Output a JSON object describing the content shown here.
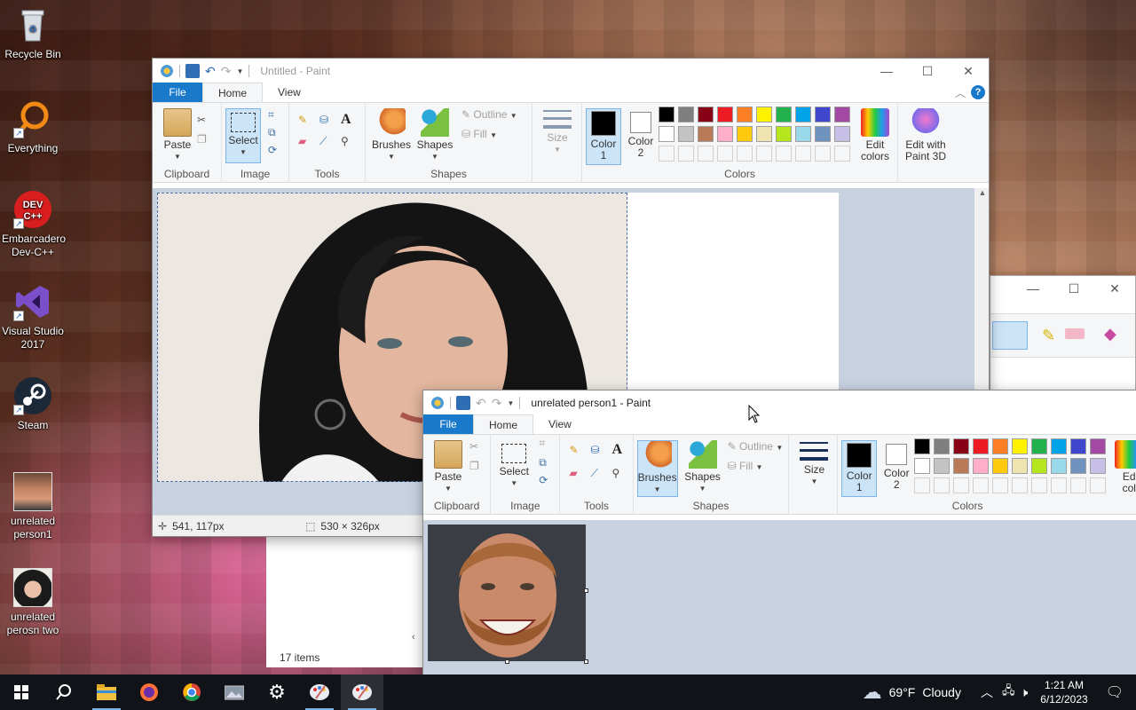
{
  "desktop": {
    "icons": [
      {
        "label": "Recycle Bin",
        "icon": "recycle-bin-icon"
      },
      {
        "label": "Everything",
        "icon": "everything-search-icon"
      },
      {
        "label": "Embarcadero Dev-C++",
        "icon": "devcpp-icon",
        "badge": "DEV C++"
      },
      {
        "label": "Visual Studio 2017",
        "icon": "visual-studio-icon"
      },
      {
        "label": "Steam",
        "icon": "steam-icon"
      },
      {
        "label": "unrelated person1",
        "icon": "image-thumbnail-icon"
      },
      {
        "label": "unrelated perosn two",
        "icon": "image-thumbnail-icon"
      }
    ]
  },
  "paint_back": {
    "title": "Untitled - Paint",
    "tabs": {
      "file": "File",
      "home": "Home",
      "view": "View"
    },
    "ribbon": {
      "paste": "Paste",
      "select": "Select",
      "brushes": "Brushes",
      "shapes": "Shapes",
      "outline": "Outline",
      "fill": "Fill",
      "size": "Size",
      "color1": "Color 1",
      "color2": "Color 2",
      "edit_colors": "Edit colors",
      "edit_paint3d": "Edit with Paint 3D",
      "groups": {
        "clipboard": "Clipboard",
        "image": "Image",
        "tools": "Tools",
        "shapes": "Shapes",
        "colors": "Colors"
      }
    },
    "status": {
      "cursor_pos": "541, 117px",
      "selection_size": "530 × 326px"
    }
  },
  "paint_front": {
    "title": "unrelated person1 - Paint",
    "tabs": {
      "file": "File",
      "home": "Home",
      "view": "View"
    },
    "ribbon": {
      "paste": "Paste",
      "select": "Select",
      "brushes": "Brushes",
      "shapes": "Shapes",
      "outline": "Outline",
      "fill": "Fill",
      "size": "Size",
      "color1": "Color 1",
      "color2": "Color 2",
      "edit_colors": "Ed col",
      "groups": {
        "clipboard": "Clipboard",
        "image": "Image",
        "tools": "Tools",
        "shapes": "Shapes",
        "colors": "Colors"
      }
    }
  },
  "explorer_back": {
    "items_count": "17 items"
  },
  "palette_row1": [
    "#000000",
    "#7f7f7f",
    "#880015",
    "#ed1c24",
    "#ff7f27",
    "#fff200",
    "#22b14c",
    "#00a2e8",
    "#3f48cc",
    "#a349a4"
  ],
  "palette_row2": [
    "#ffffff",
    "#c3c3c3",
    "#b97a57",
    "#ffaec9",
    "#ffc90e",
    "#efe4b0",
    "#b5e61d",
    "#99d9ea",
    "#7092be",
    "#c8bfe7"
  ],
  "taskbar": {
    "weather_temp": "69°F",
    "weather_text": "Cloudy",
    "time": "1:21 AM",
    "date": "6/12/2023"
  }
}
